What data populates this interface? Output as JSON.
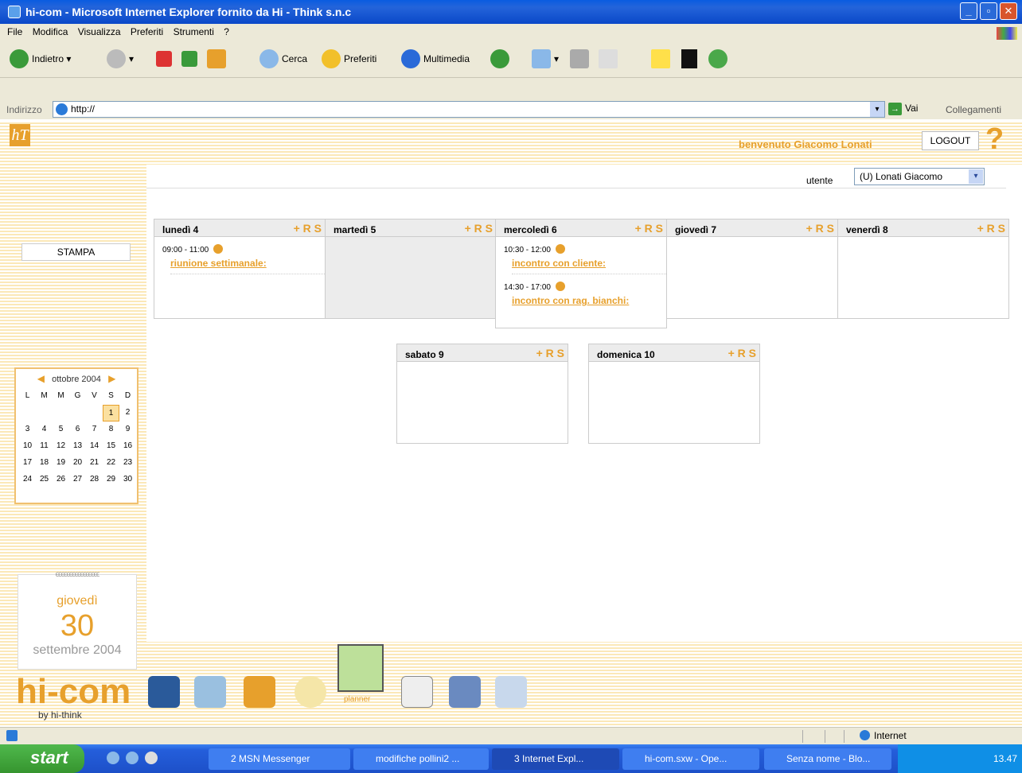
{
  "window": {
    "title": "hi-com - Microsoft Internet Explorer fornito da Hi - Think s.n.c"
  },
  "menu": [
    "File",
    "Modifica",
    "Visualizza",
    "Preferiti",
    "Strumenti",
    "?"
  ],
  "toolbar": {
    "back": "Indietro",
    "search": "Cerca",
    "favorites": "Preferiti",
    "media": "Multimedia"
  },
  "address": {
    "label": "Indirizzo",
    "value": "http://",
    "go": "Vai",
    "links": "Collegamenti"
  },
  "header": {
    "welcome": "benvenuto Giacomo Lonati",
    "logout": "LOGOUT"
  },
  "user": {
    "label": "utente",
    "selected": "(U) Lonati Giacomo"
  },
  "sidebar": {
    "print": "STAMPA"
  },
  "calendar": {
    "month": "ottobre 2004",
    "weekdays": [
      "L",
      "M",
      "M",
      "G",
      "V",
      "S",
      "D"
    ],
    "weeks": [
      [
        "",
        "",
        "",
        "",
        "",
        "1",
        "2"
      ],
      [
        "3",
        "4",
        "5",
        "6",
        "7",
        "8",
        "9"
      ],
      [
        "10",
        "11",
        "12",
        "13",
        "14",
        "15",
        "16"
      ],
      [
        "17",
        "18",
        "19",
        "20",
        "21",
        "22",
        "23"
      ],
      [
        "24",
        "25",
        "26",
        "27",
        "28",
        "29",
        "30"
      ]
    ]
  },
  "today": {
    "weekday": "giovedì",
    "day": "30",
    "month_year": "settembre 2004"
  },
  "days": [
    {
      "label": "lunedì 4",
      "actions": "+ R S",
      "events": [
        {
          "time": "09:00 - 11:00",
          "title": "riunione settimanale:"
        }
      ]
    },
    {
      "label": "martedì 5",
      "actions": "+ R S",
      "events": []
    },
    {
      "label": "mercoledì 6",
      "actions": "+ R S",
      "events": [
        {
          "time": "10:30 - 12:00",
          "title": "incontro con cliente:"
        },
        {
          "time": "14:30 - 17:00",
          "title": "incontro con rag. bianchi:"
        }
      ]
    },
    {
      "label": "giovedì 7",
      "actions": "+ R S",
      "events": []
    },
    {
      "label": "venerdì 8",
      "actions": "+ R S",
      "events": []
    },
    {
      "label": "sabato 9",
      "actions": "+ R S",
      "events": []
    },
    {
      "label": "domenica 10",
      "actions": "+ R S",
      "events": []
    }
  ],
  "footer": {
    "brand": "hi-com",
    "byline": "by hi-think",
    "planner": "planner"
  },
  "status": {
    "zone": "Internet"
  },
  "taskbar": {
    "start": "start",
    "items": [
      "2 MSN Messenger",
      "modifiche pollini2 ...",
      "3 Internet Expl...",
      "hi-com.sxw - Ope...",
      "Senza nome - Blo..."
    ],
    "clock": "13.47"
  }
}
